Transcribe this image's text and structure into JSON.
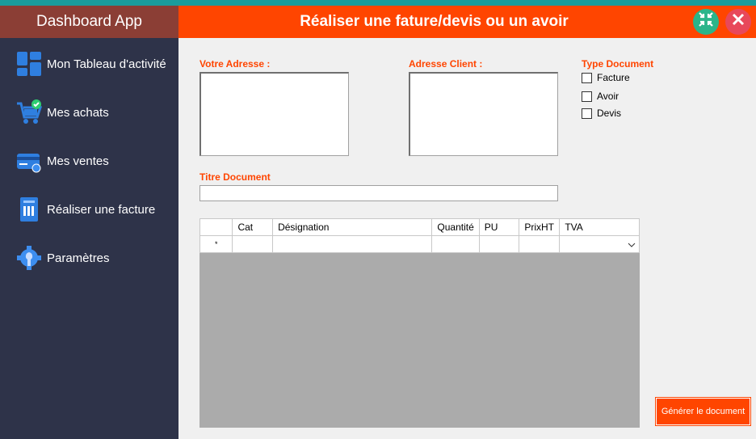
{
  "sidebar": {
    "brand": "Dashboard App",
    "items": [
      {
        "label": "Mon Tableau d'activité",
        "icon": "dashboard-icon"
      },
      {
        "label": "Mes achats",
        "icon": "shopping-cart-icon"
      },
      {
        "label": "Mes ventes",
        "icon": "credit-card-icon"
      },
      {
        "label": "Réaliser une facture",
        "icon": "invoice-icon"
      },
      {
        "label": "Paramètres",
        "icon": "settings-icon"
      }
    ]
  },
  "titlebar": {
    "title": "Réaliser une fature/devis ou un avoir"
  },
  "form": {
    "votre_adresse_label": "Votre Adresse :",
    "adresse_client_label": "Adresse Client :",
    "type_document_label": "Type Document",
    "types": [
      "Facture",
      "Avoir",
      "Devis"
    ],
    "titre_document_label": "Titre Document"
  },
  "grid": {
    "columns": [
      "",
      "Cat",
      "Désignation",
      "Quantité",
      "PU",
      "PrixHT",
      "TVA"
    ],
    "new_row_marker": "*"
  },
  "generate_button": "Générer le document"
}
